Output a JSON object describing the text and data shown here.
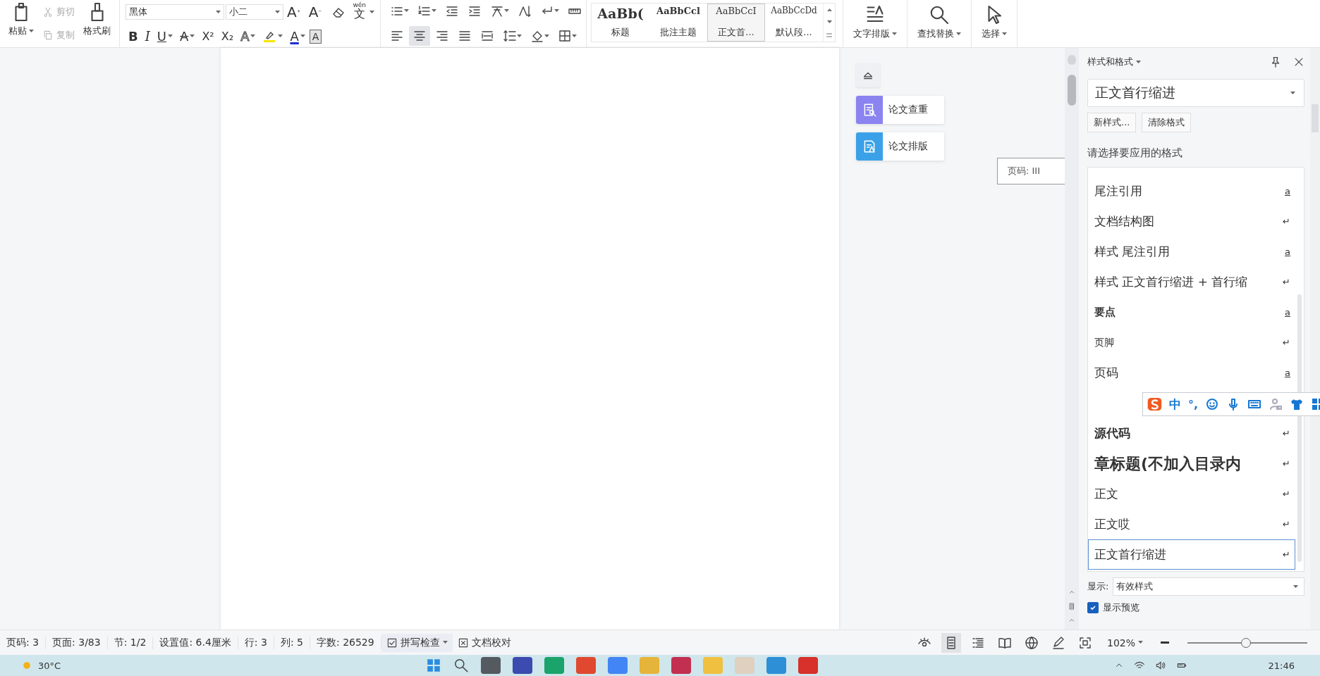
{
  "ribbon": {
    "clipboard": {
      "paste": "粘贴",
      "cut": {
        "label": "剪切",
        "disabled": true
      },
      "copy": {
        "label": "复制",
        "disabled": true
      },
      "painter": "格式刷"
    },
    "font": {
      "name": "黑体",
      "size": "小二",
      "grow": "A",
      "shrink": "A",
      "pinyin_ruby": "wén",
      "pinyin_char": "文"
    },
    "format_buttons": [
      {
        "kind": "bold",
        "label": "B"
      },
      {
        "kind": "italic",
        "label": "I"
      },
      {
        "kind": "underline",
        "label": "U"
      },
      {
        "kind": "strike",
        "label": "A"
      },
      {
        "kind": "sup",
        "label": "X²"
      },
      {
        "kind": "sub",
        "label": "X₂"
      },
      {
        "kind": "outline",
        "label": "A"
      },
      {
        "kind": "highlight"
      },
      {
        "kind": "fontcolor",
        "label": "A"
      },
      {
        "kind": "shaded",
        "label": "A"
      }
    ],
    "align_buttons": [
      {
        "kind": "left",
        "selected": false
      },
      {
        "kind": "center",
        "selected": true
      },
      {
        "kind": "right",
        "selected": false
      },
      {
        "kind": "justify",
        "selected": false
      },
      {
        "kind": "distributed",
        "selected": false
      }
    ],
    "style_gallery": [
      {
        "kind": "heading",
        "sample": "AaBb(",
        "label": "标题",
        "selected": false
      },
      {
        "kind": "comment",
        "sample": "AaBbCcl",
        "label": "批注主题",
        "selected": false
      },
      {
        "kind": "body",
        "sample": "AaBbCcI",
        "label": "正文首...",
        "selected": true
      },
      {
        "kind": "default",
        "sample": "AaBbCcDd",
        "label": "默认段...",
        "selected": false
      }
    ],
    "tools": [
      {
        "kind": "layout",
        "label": "文字排版"
      },
      {
        "kind": "find",
        "label": "查找替换"
      },
      {
        "kind": "select",
        "label": "选择"
      }
    ]
  },
  "side_buttons": [
    {
      "kind": "check",
      "label": "论文查重"
    },
    {
      "kind": "layout",
      "label": "论文排版"
    }
  ],
  "tooltip": "页码: III",
  "styles_panel": {
    "title": "样式和格式",
    "current": "正文首行缩进",
    "buttons": [
      "新样式...",
      "清除格式"
    ],
    "prompt": "请选择要应用的格式",
    "items": [
      {
        "name": "尾注引用",
        "kind": "serif",
        "mark": "a",
        "selected": false
      },
      {
        "name": "文档结构图",
        "kind": "serif",
        "mark": "↵",
        "selected": false
      },
      {
        "name": "样式  尾注引用",
        "kind": "serif",
        "mark": "a",
        "selected": false
      },
      {
        "name": "样式  正文首行缩进 + 首行缩",
        "kind": "serif",
        "mark": "↵",
        "selected": false
      },
      {
        "name": "要点",
        "kind": "bold",
        "mark": "a",
        "selected": false
      },
      {
        "name": "页脚",
        "kind": "sans",
        "mark": "↵",
        "selected": false
      },
      {
        "name": "页码",
        "kind": "serif",
        "mark": "a",
        "selected": false
      },
      {
        "name": "源代码",
        "kind": "boldserif",
        "mark": "↵",
        "selected": false
      },
      {
        "name": "章标题(不加入目录内",
        "kind": "heading",
        "mark": "↵",
        "selected": false
      },
      {
        "name": "正文",
        "kind": "serif",
        "mark": "↵",
        "selected": false
      },
      {
        "name": "正文哎",
        "kind": "serif",
        "mark": "↵",
        "selected": false
      },
      {
        "name": "正文首行缩进",
        "kind": "serif",
        "mark": "↵",
        "selected": true
      }
    ],
    "show_label": "显示:",
    "show_value": "有效样式",
    "preview": {
      "label": "显示预览",
      "checked": true
    }
  },
  "ime_bar": {
    "mode": "中",
    "punct": "°,"
  },
  "status_bar": {
    "items": [
      "页码: 3",
      "页面: 3/83",
      "节: 1/2",
      "设置值: 6.4厘米",
      "行: 3",
      "列: 5",
      "字数: 26529"
    ],
    "spell": "拼写检查",
    "proof": "文档校对",
    "views": [
      {
        "kind": "page",
        "selected": true
      },
      {
        "kind": "outline",
        "selected": false
      },
      {
        "kind": "read",
        "selected": false
      },
      {
        "kind": "web",
        "selected": false
      },
      {
        "kind": "write",
        "selected": false
      }
    ],
    "zoom": "102%",
    "zoom_slider": {
      "level": 0.49
    }
  },
  "taskbar": {
    "weather": "30°C",
    "time": "21:46"
  }
}
